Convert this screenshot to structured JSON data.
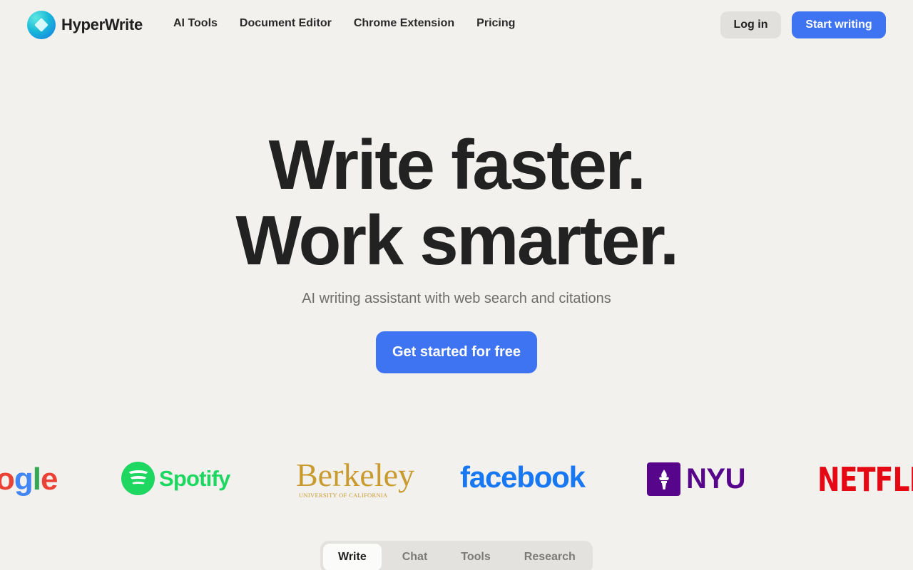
{
  "header": {
    "brand": "HyperWrite",
    "nav": [
      {
        "label": "AI Tools"
      },
      {
        "label": "Document Editor"
      },
      {
        "label": "Chrome Extension"
      },
      {
        "label": "Pricing"
      }
    ],
    "login_label": "Log in",
    "start_label": "Start writing"
  },
  "hero": {
    "title_line1": "Write faster.",
    "title_line2": "Work smarter.",
    "subtitle": "AI writing assistant with web search and citations",
    "cta_label": "Get started for free"
  },
  "logos": {
    "google": {
      "part1": "o",
      "part2": "g",
      "part3": "l",
      "part4": "e"
    },
    "spotify": "Spotify",
    "berkeley": {
      "name": "Berkeley",
      "sub": "UNIVERSITY OF CALIFORNIA"
    },
    "facebook": "facebook",
    "nyu": {
      "glyph": "🔥",
      "text": "NYU"
    },
    "netflix": "NETFLIX"
  },
  "tabs": [
    {
      "label": "Write",
      "active": true
    },
    {
      "label": "Chat",
      "active": false
    },
    {
      "label": "Tools",
      "active": false
    },
    {
      "label": "Research",
      "active": false
    }
  ],
  "colors": {
    "background": "#f2f1ee",
    "accent": "#3e73f2",
    "text": "#222222"
  },
  "icons": {
    "brand": "hyperwrite-logo-icon",
    "spotify": "spotify-icon",
    "nyu": "nyu-torch-icon"
  }
}
